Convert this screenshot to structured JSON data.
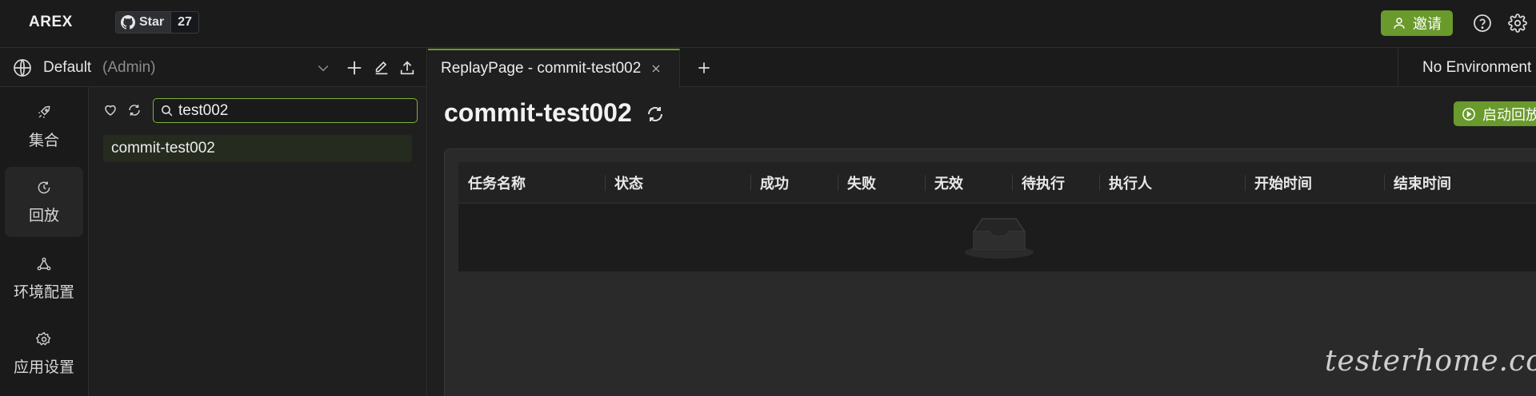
{
  "app": {
    "logo": "AREX",
    "github": {
      "star_label": "Star",
      "star_count": "27"
    },
    "invite_label": "邀请"
  },
  "workspace": {
    "name": "Default",
    "role": "(Admin)"
  },
  "rail": [
    {
      "label": "集合",
      "icon": "rocket-icon"
    },
    {
      "label": "回放",
      "icon": "replay-clock-icon"
    },
    {
      "label": "环境配置",
      "icon": "environment-nodes-icon"
    },
    {
      "label": "应用设置",
      "icon": "gear-icon"
    }
  ],
  "tree": {
    "search_value": "test002",
    "nodes": [
      {
        "label": "commit-test002"
      }
    ]
  },
  "tabs": [
    {
      "label": "ReplayPage - commit-test002"
    }
  ],
  "environment": {
    "label": "No Environment"
  },
  "main": {
    "title": "commit-test002",
    "start_button_label": "启动回放",
    "table": {
      "columns": [
        "任务名称",
        "状态",
        "成功",
        "失败",
        "无效",
        "待执行",
        "执行人",
        "开始时间",
        "结束时间"
      ],
      "rows": []
    }
  },
  "watermark": "testerhome.com",
  "colors": {
    "accent": "#6a9a2c",
    "focus_border": "#7fb33a",
    "background": "#1c1c1c"
  }
}
